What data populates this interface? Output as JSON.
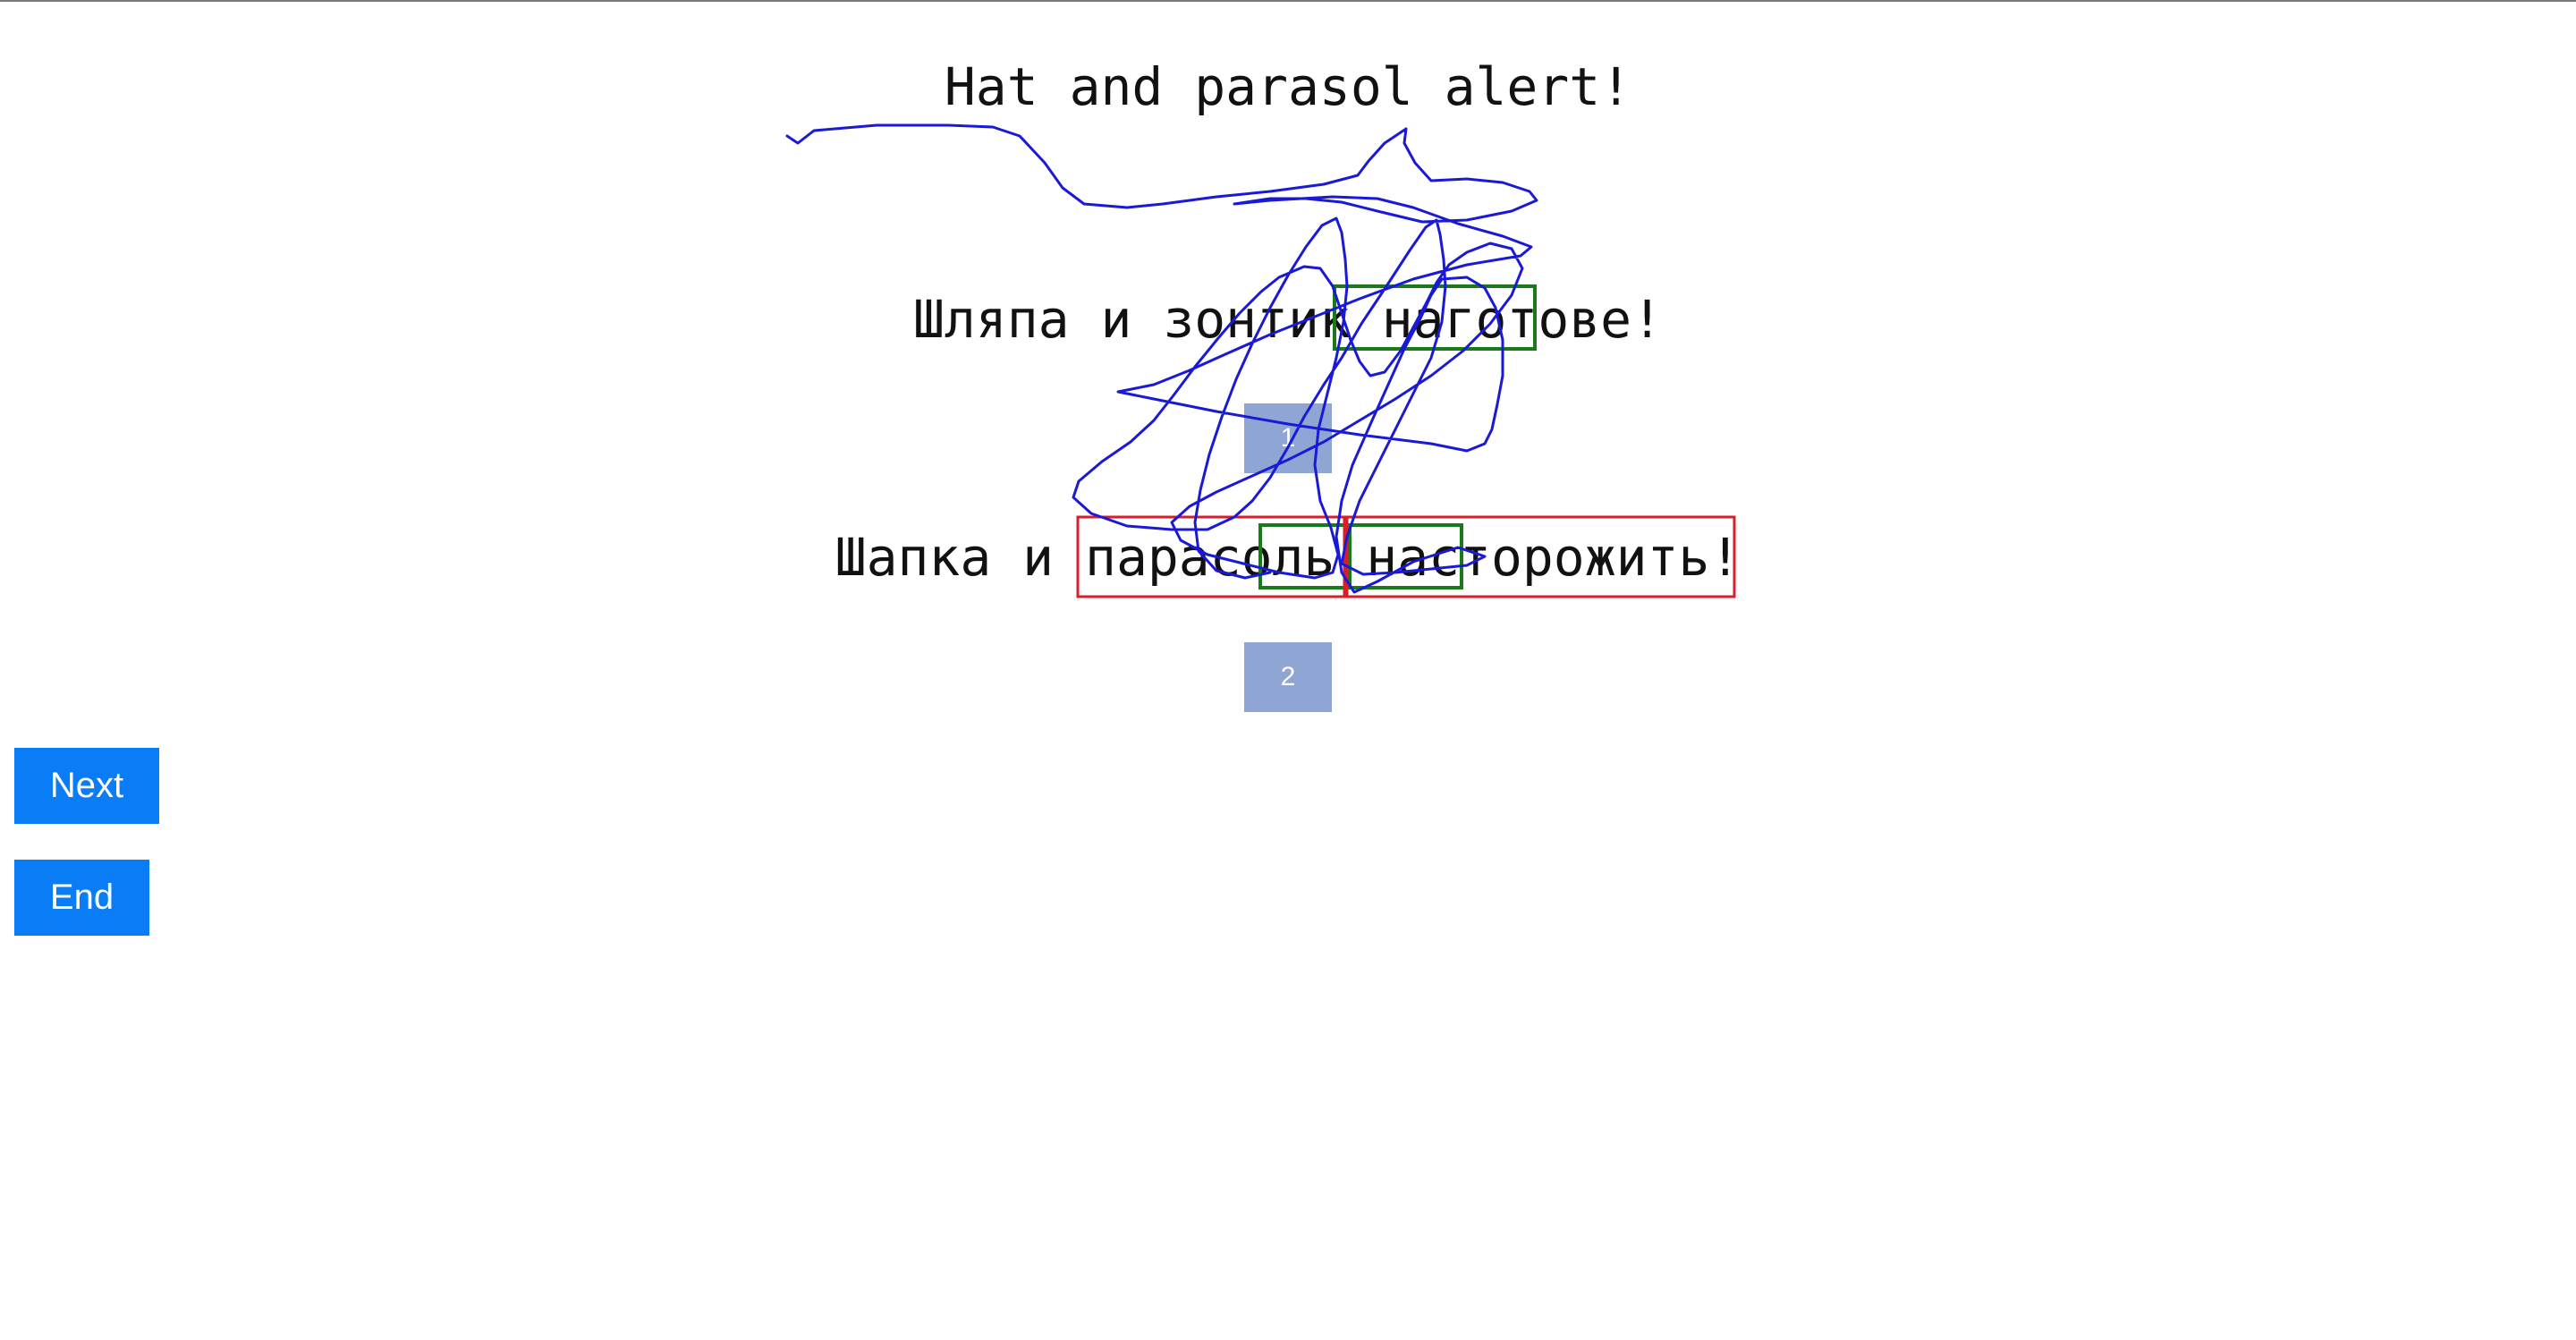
{
  "source_sentence": "Hat and parasol alert!",
  "translations": [
    {
      "text": "Шляпа и зонтик наготове!",
      "badge": "1"
    },
    {
      "text": "Шапка и парасоль насторожить!",
      "badge": "2"
    }
  ],
  "buttons": {
    "next_label": "Next",
    "end_label": "End"
  },
  "colors": {
    "button_bg": "#0a7df6",
    "badge_bg": "#8fa6d4",
    "stroke": "#1a1ad6",
    "green_box": "#1a7a1a",
    "red_box": "#d81e2a"
  }
}
